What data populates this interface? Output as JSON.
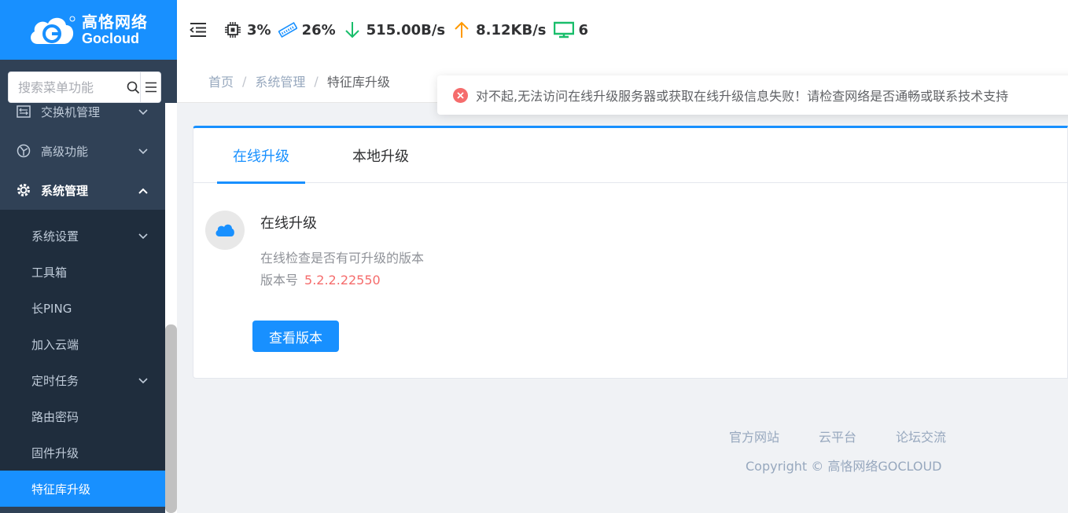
{
  "brand": {
    "name_cn": "高恪网络",
    "name_en": "Gocloud",
    "accent": "#1890ff",
    "sidebar_bg": "#304156"
  },
  "search": {
    "placeholder": "搜索菜单功能"
  },
  "sidebar": {
    "items": [
      {
        "label": "交换机管理",
        "icon": "switch-icon"
      },
      {
        "label": "高级功能",
        "icon": "advanced-icon"
      },
      {
        "label": "系统管理",
        "icon": "gear-icon",
        "open": true
      }
    ],
    "sub_items": [
      {
        "label": "系统设置",
        "has_children": true
      },
      {
        "label": "工具箱"
      },
      {
        "label": "长PING"
      },
      {
        "label": "加入云端"
      },
      {
        "label": "定时任务",
        "has_children": true
      },
      {
        "label": "路由密码"
      },
      {
        "label": "固件升级"
      },
      {
        "label": "特征库升级",
        "active": true
      }
    ]
  },
  "topbar": {
    "cpu": "3%",
    "memory": "26%",
    "download": "515.00B/s",
    "upload": "8.12KB/s",
    "terminals": "6"
  },
  "breadcrumb": [
    "首页",
    "系统管理",
    "特征库升级"
  ],
  "toast": {
    "type": "error",
    "message": "对不起,无法访问在线升级服务器或获取在线升级信息失败！请检查网络是否通畅或联系技术支持"
  },
  "tabs": [
    {
      "label": "在线升级",
      "active": true
    },
    {
      "label": "本地升级"
    }
  ],
  "upgrade": {
    "title": "在线升级",
    "description": "在线检查是否有可升级的版本",
    "version_label": "版本号",
    "version": "5.2.2.22550",
    "button": "查看版本"
  },
  "footer": {
    "links": [
      "官方网站",
      "云平台",
      "论坛交流"
    ],
    "copyright": "Copyright © 高恪网络GOCLOUD"
  }
}
